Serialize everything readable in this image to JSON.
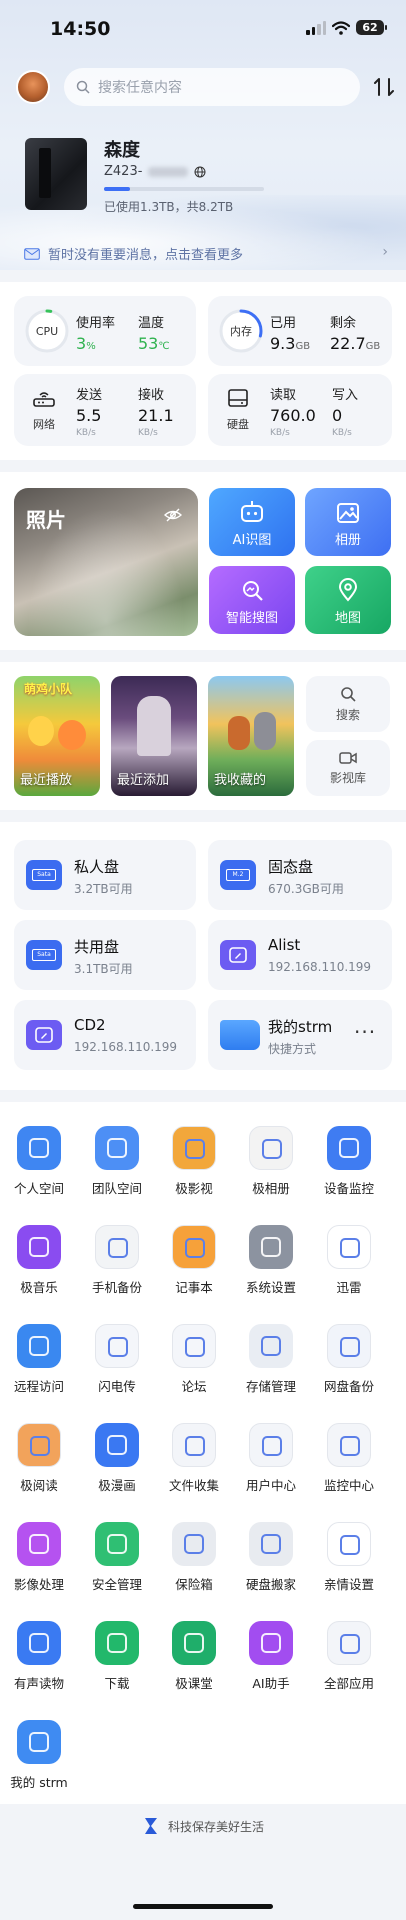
{
  "status_bar": {
    "time": "14:50",
    "battery": "62"
  },
  "search": {
    "placeholder": "搜索任意内容"
  },
  "device": {
    "name": "森度",
    "id": "Z423-",
    "usage_text": "已使用1.3TB，共8.2TB",
    "usage_fraction": 0.16
  },
  "notice": {
    "text": "暂时没有重要消息，点击查看更多"
  },
  "stats": {
    "cpu": {
      "label": "CPU",
      "usage_label": "使用率",
      "usage_value": "3",
      "usage_unit": "%",
      "temp_label": "温度",
      "temp_value": "53",
      "temp_unit": "℃",
      "usage_fraction": 0.03
    },
    "memory": {
      "label": "内存",
      "used_label": "已用",
      "used_value": "9.3",
      "used_unit": "GB",
      "free_label": "剩余",
      "free_value": "22.7",
      "free_unit": "GB",
      "used_fraction": 0.29
    },
    "network": {
      "label": "网络",
      "send_label": "发送",
      "send_value": "5.5",
      "send_unit": "KB/s",
      "recv_label": "接收",
      "recv_value": "21.1",
      "recv_unit": "KB/s"
    },
    "disk": {
      "label": "硬盘",
      "read_label": "读取",
      "read_value": "760.0",
      "read_unit": "KB/s",
      "write_label": "写入",
      "write_value": "0",
      "write_unit": "KB/s"
    }
  },
  "media": {
    "photos_title": "照片",
    "tiles": [
      "AI识图",
      "相册",
      "智能搜图",
      "地图"
    ],
    "posters": [
      "最近播放",
      "最近添加",
      "我收藏的"
    ],
    "poster_caption": "萌鸡小队",
    "side_buttons": [
      "搜索",
      "影视库"
    ]
  },
  "disks": [
    {
      "name": "私人盘",
      "sub": "3.2TB可用",
      "badge": "Sata"
    },
    {
      "name": "固态盘",
      "sub": "670.3GB可用",
      "badge": "M.2"
    },
    {
      "name": "共用盘",
      "sub": "3.1TB可用",
      "badge": "Sata"
    },
    {
      "name": "Alist",
      "sub": "192.168.110.199",
      "badge": ""
    },
    {
      "name": "CD2",
      "sub": "192.168.110.199",
      "badge": ""
    },
    {
      "name": "我的strm",
      "sub": "快捷方式",
      "badge": ""
    }
  ],
  "apps": [
    {
      "label": "个人空间",
      "icon": "folder-icon",
      "color": "#3f86f2"
    },
    {
      "label": "团队空间",
      "icon": "team-folder-icon",
      "color": "#4d8ff5"
    },
    {
      "label": "极影视",
      "icon": "film-icon",
      "color": "#f2a73b"
    },
    {
      "label": "极相册",
      "icon": "flower-icon",
      "color": "#f3f3f3"
    },
    {
      "label": "设备监控",
      "icon": "monitor-wave-icon",
      "color": "#3f7cf2"
    },
    {
      "label": "极音乐",
      "icon": "music-disc-icon",
      "color": "#8a4cf0"
    },
    {
      "label": "手机备份",
      "icon": "phone-backup-icon",
      "color": "#f2f4f6"
    },
    {
      "label": "记事本",
      "icon": "notebook-icon",
      "color": "#f6a13a"
    },
    {
      "label": "系统设置",
      "icon": "gear-icon",
      "color": "#8c93a0"
    },
    {
      "label": "迅雷",
      "icon": "thunder-bird-icon",
      "color": "#ffffff"
    },
    {
      "label": "远程访问",
      "icon": "remote-icon",
      "color": "#3a88f0"
    },
    {
      "label": "闪电传",
      "icon": "lightning-icon",
      "color": "#f4f6fa"
    },
    {
      "label": "论坛",
      "icon": "chat-icon",
      "color": "#f4f6fa"
    },
    {
      "label": "存储管理",
      "icon": "storage-icon",
      "color": "#e9edf3"
    },
    {
      "label": "网盘备份",
      "icon": "cloud-upload-icon",
      "color": "#f1f4fa"
    },
    {
      "label": "极阅读",
      "icon": "book-icon",
      "color": "#f2a35b"
    },
    {
      "label": "极漫画",
      "icon": "comic-icon",
      "color": "#3a78f2"
    },
    {
      "label": "文件收集",
      "icon": "inbox-icon",
      "color": "#f3f5f9"
    },
    {
      "label": "用户中心",
      "icon": "user-icon",
      "color": "#f3f5f9"
    },
    {
      "label": "监控中心",
      "icon": "camera-icon",
      "color": "#f3f5f9"
    },
    {
      "label": "影像处理",
      "icon": "image-edit-icon",
      "color": "#b552f0"
    },
    {
      "label": "安全管理",
      "icon": "shield-icon",
      "color": "#2fbf73"
    },
    {
      "label": "保险箱",
      "icon": "safe-icon",
      "color": "#e8ebf0"
    },
    {
      "label": "硬盘搬家",
      "icon": "disk-move-icon",
      "color": "#e8ebf0"
    },
    {
      "label": "亲情设置",
      "icon": "family-link-icon",
      "color": "#ffffff"
    },
    {
      "label": "有声读物",
      "icon": "audio-wave-icon",
      "color": "#3a7af2"
    },
    {
      "label": "下载",
      "icon": "download-icon",
      "color": "#22b86b"
    },
    {
      "label": "极课堂",
      "icon": "graduation-cap-icon",
      "color": "#1fae6a"
    },
    {
      "label": "AI助手",
      "icon": "ai-robot-icon",
      "color": "#a24df0"
    },
    {
      "label": "全部应用",
      "icon": "grid-apps-icon",
      "color": "#f3f5f9"
    },
    {
      "label": "我的 strm",
      "icon": "folder-shortcut-icon",
      "color": "#3f8bf2"
    }
  ],
  "footer": {
    "slogan": "科技保存美好生活"
  }
}
